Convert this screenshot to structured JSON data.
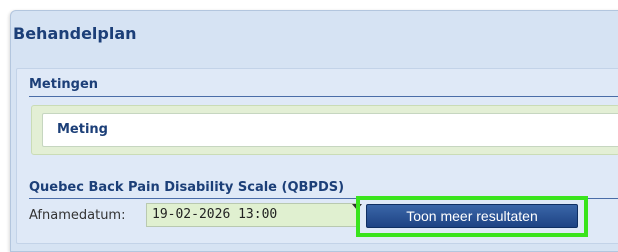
{
  "panel": {
    "title": "Behandelplan"
  },
  "metingen": {
    "title": "Metingen",
    "item_label": "Meting"
  },
  "scale": {
    "title": "Quebec Back Pain Disability Scale (QBPDS)",
    "date_label": "Afnamedatum:",
    "date_value": "19-02-2026 13:00",
    "more_button_label": "Toon meer resultaten"
  },
  "colors": {
    "heading_blue": "#1c3f78",
    "panel_bg": "#d6e3f3",
    "button_blue": "#1e4384",
    "highlight_green": "#39e41c"
  }
}
